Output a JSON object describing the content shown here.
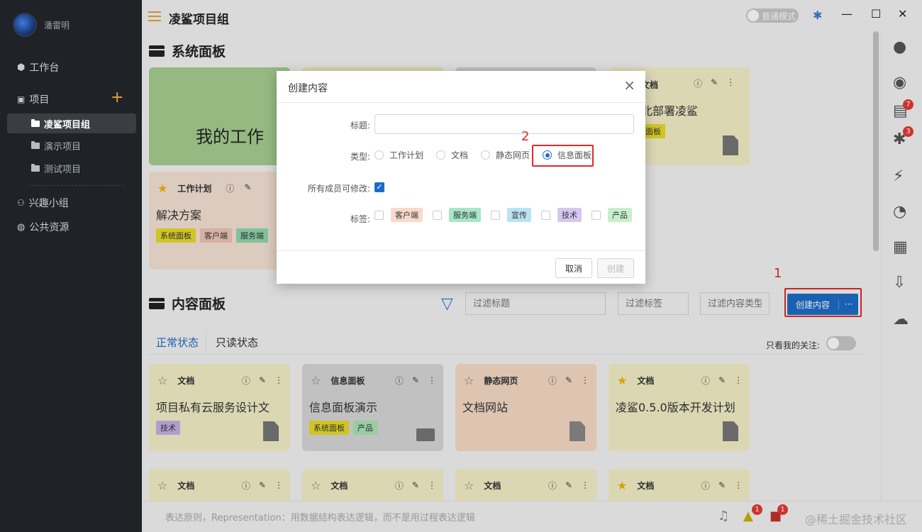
{
  "sidebar": {
    "user_name": "潘雷明",
    "workbench": "工作台",
    "projects": "项目",
    "project_items": [
      "凌鲨项目组",
      "演示项目",
      "测试项目"
    ],
    "interest_group": "兴趣小组",
    "public_resources": "公共资源"
  },
  "topbar": {
    "group_title": "凌鲨项目组",
    "mode_toggle": "普通模式"
  },
  "system_panel": {
    "title": "系统面板",
    "card_big_text": "我的工作",
    "card_partial_type": "文档",
    "card_partial_title": "北部署凌鲨",
    "card_partial_tag": "面板",
    "plan_card": {
      "type": "工作计划",
      "title": "解决方案",
      "tags": [
        "系统面板",
        "客户端",
        "服务端"
      ]
    }
  },
  "content_panel": {
    "title": "内容面板",
    "filter_title_placeholder": "过滤标题",
    "filter_tag_placeholder": "过滤标签",
    "filter_type_placeholder": "过滤内容类型",
    "create_button": "创建内容",
    "more_button": "···",
    "annotation_1": "1",
    "tabs": [
      "正常状态",
      "只读状态"
    ],
    "focus_only_label": "只看我的关注:",
    "cards": [
      {
        "type": "文档",
        "title": "项目私有云服务设计文",
        "tags": [
          "技术"
        ],
        "bg": "#f4f0c8"
      },
      {
        "type": "信息面板",
        "title": "信息面板演示",
        "tags": [
          "系统面板",
          "产品"
        ],
        "bg": "#d7d7d7"
      },
      {
        "type": "静态网页",
        "title": "文档网站",
        "tags": [],
        "bg": "#f7dcc6"
      },
      {
        "type": "文档",
        "title": "凌鲨0.5.0版本开发计划",
        "tags": [],
        "bg": "#f4f0c8"
      }
    ],
    "row2_types": [
      "文档",
      "文档",
      "文档",
      "文档"
    ]
  },
  "dialog": {
    "title": "创建内容",
    "label_title": "标题:",
    "label_type": "类型:",
    "label_all_edit": "所有成员可修改:",
    "label_tags": "标签:",
    "type_options": [
      "工作计划",
      "文档",
      "静态网页",
      "信息面板"
    ],
    "selected_type": "信息面板",
    "all_edit_checked": true,
    "annotation_2": "2",
    "tag_options": [
      {
        "name": "客户端",
        "color": "#f9d9c9"
      },
      {
        "name": "服务端",
        "color": "#a8e6c6"
      },
      {
        "name": "宣传",
        "color": "#b9e4f4"
      },
      {
        "name": "技术",
        "color": "#d6c6f0"
      },
      {
        "name": "产品",
        "color": "#c6f0cc"
      }
    ],
    "cancel_button": "取消",
    "create_button": "创建"
  },
  "statusbar": {
    "text": "表达原则，Representation：用数据结构表达逻辑，而不是用过程表达逻辑",
    "watermark": "@稀土掘金技术社区",
    "badge_1": "1",
    "badge_2": "1"
  },
  "right_rail": {
    "doc_badge": "7",
    "bug_badge": "3"
  },
  "colors": {
    "accent": "#1f6cc6",
    "annotation_red": "#e02a2a",
    "sidebar_bg": "#1f2227"
  }
}
